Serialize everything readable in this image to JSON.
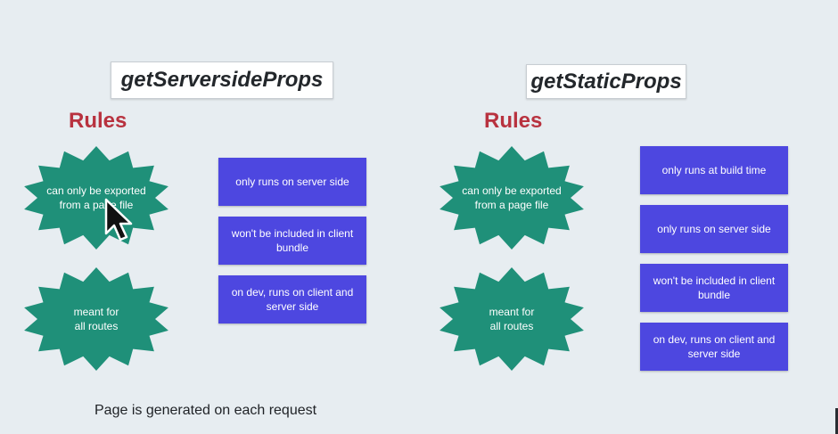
{
  "left": {
    "title": "getServersideProps",
    "rules_heading": "Rules",
    "bursts": [
      "can only be exported\nfrom a page file",
      "meant for\nall routes"
    ],
    "boxes": [
      "only runs on server side",
      "won't be included in client bundle",
      "on dev, runs on client and server side"
    ],
    "footer": "Page is generated on each request"
  },
  "right": {
    "title": "getStaticProps",
    "rules_heading": "Rules",
    "bursts": [
      "can only be exported\nfrom a page file",
      "meant for\nall routes"
    ],
    "boxes": [
      "only runs at build time",
      "only runs on server side",
      "won't be included in client bundle",
      "on dev, runs on client and server side"
    ]
  },
  "colors": {
    "background": "#e7edf1",
    "burst": "#1f9079",
    "box": "#4d47e0",
    "rules_heading": "#b8323f"
  },
  "icons": [
    "mouse-pointer-icon"
  ]
}
